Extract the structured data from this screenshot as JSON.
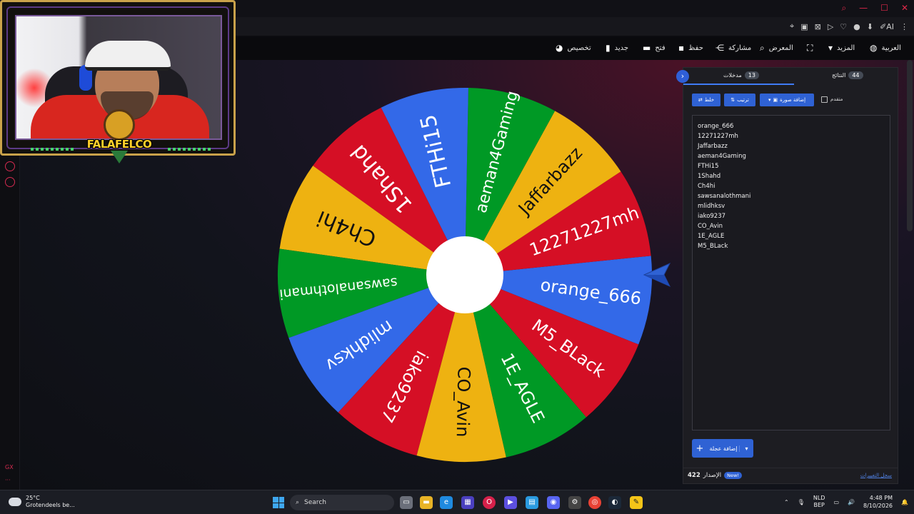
{
  "browser": {
    "window_controls": [
      "⌕",
      "—",
      "☐",
      "✕"
    ],
    "ext_icons": [
      "⌖",
      "▣",
      "⊠",
      "▷",
      "♡",
      "●",
      "⬇",
      "✐AI",
      "⋮"
    ]
  },
  "toolbar": {
    "items": [
      {
        "label": "العربية",
        "icon": "globe-icon"
      },
      {
        "label": "المزيد",
        "icon": "caret-down-icon"
      },
      {
        "label": "",
        "icon": "fullscreen-icon"
      },
      {
        "label": "المعرض",
        "icon": "search-icon"
      },
      {
        "label": "مشاركة",
        "icon": "share-icon"
      },
      {
        "label": "حفظ",
        "icon": "save-icon"
      },
      {
        "label": "فتح",
        "icon": "folder-icon"
      },
      {
        "label": "جديد",
        "icon": "file-icon"
      },
      {
        "label": "تخصيص",
        "icon": "palette-icon"
      }
    ]
  },
  "left_sidebar": {
    "gx_label": "GX",
    "more_label": "···"
  },
  "webcam": {
    "logo_text": "FALAFELCO"
  },
  "wheel": {
    "colors": [
      "#3369e8",
      "#d50f25",
      "#eeb211",
      "#009925"
    ],
    "segments": [
      {
        "label": "orange_666",
        "color": "#3369e8"
      },
      {
        "label": "12271227mh",
        "color": "#d50f25"
      },
      {
        "label": "Jaffarbazz",
        "color": "#eeb211"
      },
      {
        "label": "aeman4Gaming",
        "color": "#009925"
      },
      {
        "label": "FTHi15",
        "color": "#3369e8"
      },
      {
        "label": "1Shahd",
        "color": "#d50f25"
      },
      {
        "label": "Ch4hi",
        "color": "#eeb211"
      },
      {
        "label": "sawsanalothmani",
        "color": "#009925"
      },
      {
        "label": "mlidhksv",
        "color": "#3369e8"
      },
      {
        "label": "iako9237",
        "color": "#d50f25"
      },
      {
        "label": "CO_Avin",
        "color": "#eeb211"
      },
      {
        "label": "1E_AGLE",
        "color": "#009925"
      },
      {
        "label": "M5_BLack",
        "color": "#d50f25"
      }
    ]
  },
  "panel": {
    "tab_entries_label": "مدخلات",
    "tab_entries_count": "13",
    "tab_results_label": "النتائج",
    "tab_results_count": "44",
    "collapse_icon": "›",
    "shuffle_label": "خلط",
    "sort_label": "ترتيب",
    "add_image_label": "إضافة صورة",
    "advanced_label": "متقدم",
    "entries": [
      "orange_666",
      "12271227mh",
      "Jaffarbazz",
      "aeman4Gaming",
      "FTHi15",
      "1Shahd",
      "Ch4hi",
      "sawsanalothmani",
      "mlidhksv",
      "iako9237",
      "CO_Avin",
      "1E_AGLE",
      "M5_BLack"
    ],
    "add_wheel_label": "إضافة عجلة",
    "version_label": "الإصدار",
    "version_number": "422",
    "new_badge": "New!",
    "changelog_label": "سجل التغييرات"
  },
  "taskbar": {
    "temperature": "25°C",
    "weather_desc": "Grotendeels be...",
    "search_placeholder": "Search",
    "lang_line1": "NLD",
    "lang_line2": "BEP",
    "time": "4:48 PM",
    "date": "8/10/2026",
    "tray_up": "⌃",
    "tray_mic": "🎙",
    "tray_display": "▭",
    "tray_sound": "🔊",
    "tray_bell": "🔔"
  }
}
